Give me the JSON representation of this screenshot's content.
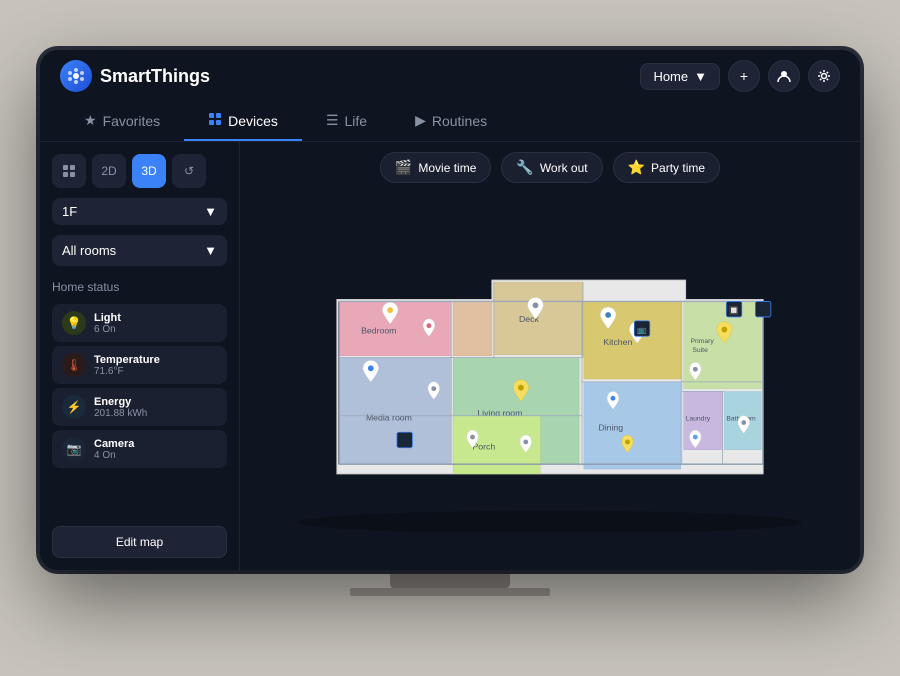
{
  "app": {
    "name": "SmartThings",
    "logo": "⚙"
  },
  "header": {
    "home_label": "Home",
    "add_label": "+",
    "profile_icon": "profile-icon",
    "settings_icon": "settings-icon"
  },
  "nav": {
    "tabs": [
      {
        "id": "favorites",
        "label": "Favorites",
        "icon": "★",
        "active": false
      },
      {
        "id": "devices",
        "label": "Devices",
        "icon": "▦",
        "active": true
      },
      {
        "id": "life",
        "label": "Life",
        "icon": "☰",
        "active": false
      },
      {
        "id": "routines",
        "label": "Routines",
        "icon": "▶",
        "active": false
      }
    ]
  },
  "sidebar": {
    "view_buttons": [
      {
        "id": "grid",
        "label": "⊞",
        "active": false
      },
      {
        "id": "2d",
        "label": "2D",
        "active": false
      },
      {
        "id": "3d",
        "label": "3D",
        "active": true
      },
      {
        "id": "history",
        "label": "↺",
        "active": false
      }
    ],
    "floor_selector": {
      "value": "1F",
      "arrow": "▼"
    },
    "room_selector": {
      "value": "All rooms",
      "arrow": "▼"
    },
    "home_status_title": "Home status",
    "status_items": [
      {
        "id": "light",
        "icon": "💡",
        "label": "Light",
        "value": "6 On",
        "type": "light"
      },
      {
        "id": "temperature",
        "icon": "🌡",
        "label": "Temperature",
        "value": "71.6°F",
        "type": "temp"
      },
      {
        "id": "energy",
        "icon": "⚡",
        "label": "Energy",
        "value": "201.88 kWh",
        "type": "energy"
      },
      {
        "id": "camera",
        "icon": "📷",
        "label": "Camera",
        "value": "4 On",
        "type": "camera"
      }
    ],
    "edit_map_label": "Edit map"
  },
  "scenes": [
    {
      "id": "movie",
      "icon": "🎬",
      "label": "Movie time"
    },
    {
      "id": "workout",
      "icon": "🔧",
      "label": "Work out"
    },
    {
      "id": "party",
      "icon": "⭐",
      "label": "Party time"
    }
  ]
}
